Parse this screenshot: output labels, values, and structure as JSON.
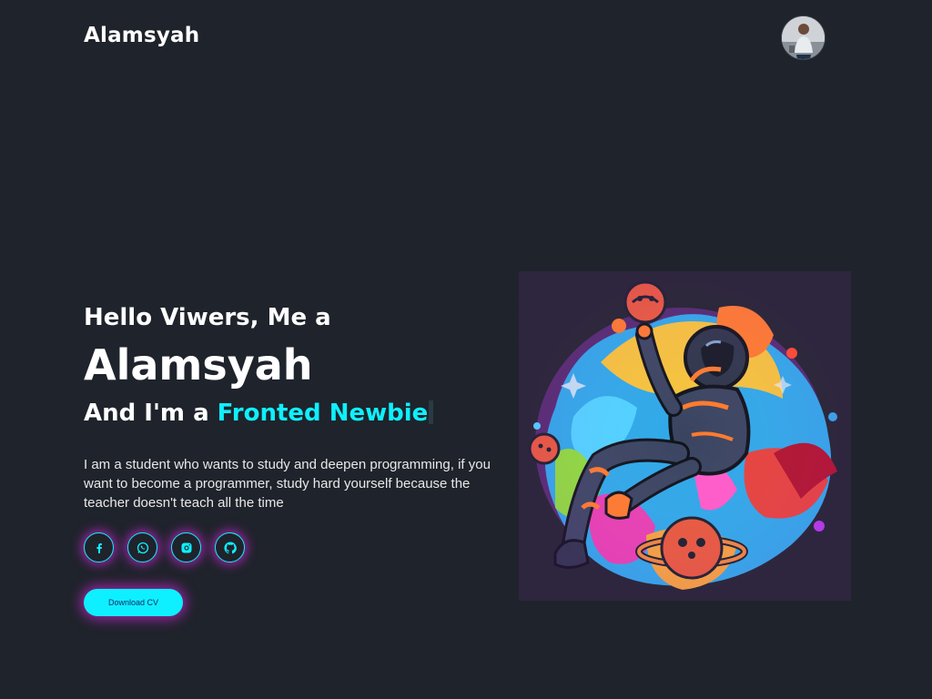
{
  "header": {
    "logo": "Alamsyah"
  },
  "hero": {
    "greeting": "Hello Viwers, Me a",
    "name": "Alamsyah",
    "role_prefix": "And I'm a ",
    "role_highlight": "Fronted Newbie",
    "description": "I am a student who wants to study and deepen programming, if you want to become a programmer, study hard yourself because the teacher doesn't teach all the time"
  },
  "socials": [
    {
      "icon": "facebook-icon"
    },
    {
      "icon": "whatsapp-icon"
    },
    {
      "icon": "instagram-icon"
    },
    {
      "icon": "github-icon"
    }
  ],
  "cta": {
    "download_label": "Download CV"
  },
  "colors": {
    "background": "#1f232b",
    "accent": "#0ef0ff",
    "glow": "#d828e6"
  }
}
